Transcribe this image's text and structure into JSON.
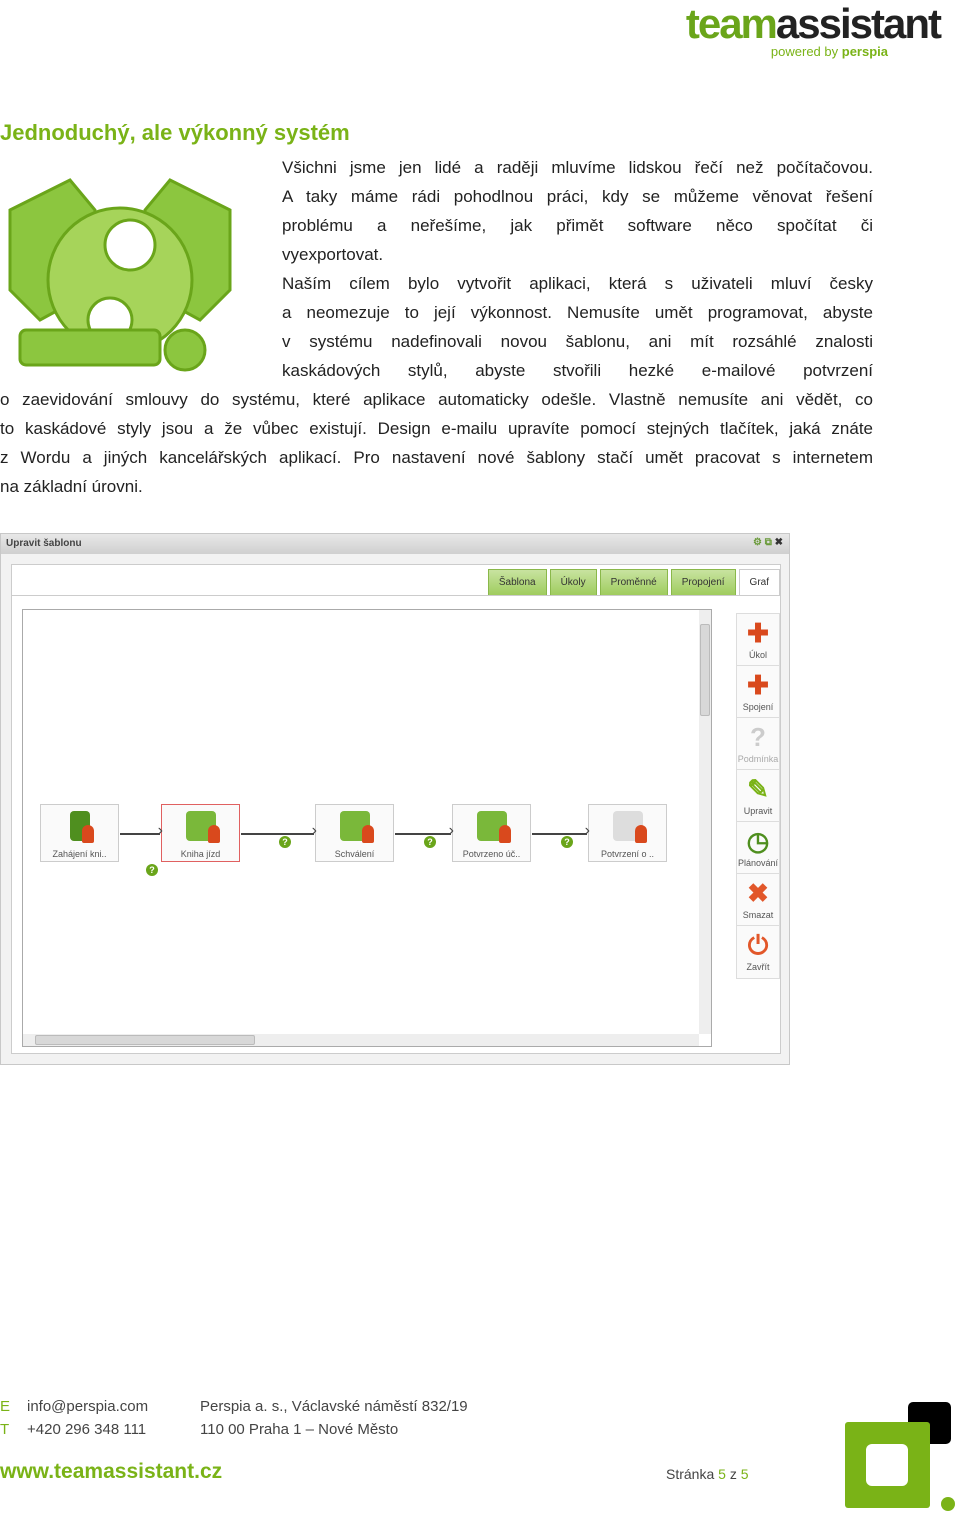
{
  "logo": {
    "brand_a": "team",
    "brand_b": "assistant",
    "powered": "powered by",
    "perspia": "perspia"
  },
  "heading": "Jednoduchý, ale výkonný systém",
  "paragraphs": [
    [
      "Všichni jsme jen lidé a raději mluvíme lidskou řečí než počítačovou.",
      "A taky máme rádi pohodlnou práci, kdy se můžeme věnovat řešení",
      "problému a neřešíme, jak přimět software něco spočítat či",
      "vyexportovat."
    ],
    [
      "Naším cílem bylo vytvořit aplikaci, která s uživateli mluví česky",
      "a neomezuje to její výkonnost. Nemusíte umět programovat, abyste",
      "v systému nadefinovali novou šablonu, ani mít rozsáhlé znalosti",
      "kaskádových stylů, abyste stvořili hezké e-mailové potvrzení",
      "o zaevidování smlouvy do systému, které aplikace automaticky odešle. Vlastně nemusíte ani vědět, co",
      "to kaskádové styly jsou a že vůbec existují.  Design e-mailu upravíte pomocí stejných tlačítek, jaká znáte",
      "z Wordu a jiných kancelářských aplikací. Pro nastavení nové šablony stačí umět pracovat s internetem",
      "na základní úrovni."
    ]
  ],
  "window": {
    "title": "Upravit šablonu",
    "tabs": [
      "Šablona",
      "Úkoly",
      "Proměnné",
      "Propojení",
      "Graf"
    ],
    "active_tab": "Graf",
    "nodes": [
      "Zahájení kni..",
      "Kniha jízd",
      "Schválení",
      "Potvrzeno úč..",
      "Potvrzení o .."
    ],
    "tools": [
      "Úkol",
      "Spojení",
      "Podmínka",
      "Upravit",
      "Plánování",
      "Smazat",
      "Zavřít"
    ],
    "colors": {
      "accent": "#7ab317",
      "danger": "#d9491d"
    }
  },
  "footer": {
    "e_label": "E",
    "email": "info@perspia.com",
    "t_label": "T",
    "phone": "+420 296 348 111",
    "address1": "Perspia a. s., Václavské náměstí 832/19",
    "address2": "110 00  Praha 1 – Nové Město",
    "web": "www.teamassistant.cz",
    "page_prefix": "Stránka",
    "page": "5",
    "page_sep": "z",
    "pages": "5"
  }
}
